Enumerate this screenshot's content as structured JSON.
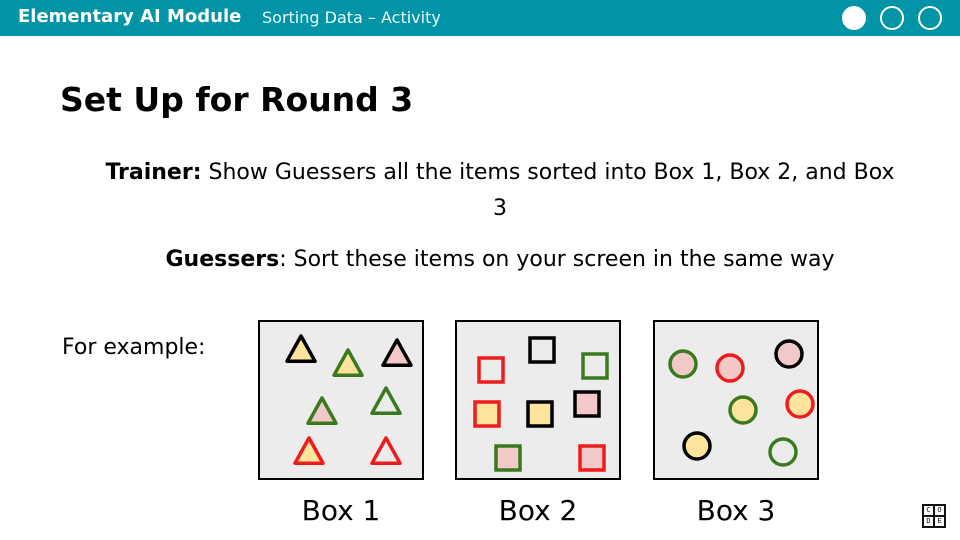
{
  "header": {
    "module_title": "Elementary AI Module",
    "activity_title": "Sorting Data – Activity",
    "progress_total": 3,
    "progress_current": 1,
    "color": "#0094a6"
  },
  "slide": {
    "title": "Set Up for Round 3",
    "trainer_label": "Trainer:",
    "trainer_text": "Show Guessers all the items sorted into Box 1, Box 2, and Box 3",
    "guessers_label": "Guessers",
    "guessers_text": ": Sort these items on your screen in the same way",
    "example_label": "For example:"
  },
  "colors": {
    "black": "#000000",
    "yellow": "#fde39b",
    "green": "#3a7a1f",
    "red": "#ee1c1c",
    "pink": "#f2c8c8",
    "box_bg": "#ececec"
  },
  "boxes": [
    {
      "label": "Box 1",
      "items": [
        {
          "shape": "triangle",
          "outline": "black",
          "fill": "yellow"
        },
        {
          "shape": "triangle",
          "outline": "green",
          "fill": "yellow"
        },
        {
          "shape": "triangle",
          "outline": "black",
          "fill": "pink"
        },
        {
          "shape": "triangle",
          "outline": "green",
          "fill": "pink"
        },
        {
          "shape": "triangle",
          "outline": "green",
          "fill": "none"
        },
        {
          "shape": "triangle",
          "outline": "red",
          "fill": "yellow"
        },
        {
          "shape": "triangle",
          "outline": "red",
          "fill": "none"
        }
      ]
    },
    {
      "label": "Box 2",
      "items": [
        {
          "shape": "square",
          "outline": "red",
          "fill": "none"
        },
        {
          "shape": "square",
          "outline": "black",
          "fill": "none"
        },
        {
          "shape": "square",
          "outline": "green",
          "fill": "none"
        },
        {
          "shape": "square",
          "outline": "red",
          "fill": "yellow"
        },
        {
          "shape": "square",
          "outline": "black",
          "fill": "yellow"
        },
        {
          "shape": "square",
          "outline": "black",
          "fill": "pink"
        },
        {
          "shape": "square",
          "outline": "green",
          "fill": "pink"
        },
        {
          "shape": "square",
          "outline": "red",
          "fill": "pink"
        }
      ]
    },
    {
      "label": "Box 3",
      "items": [
        {
          "shape": "circle",
          "outline": "green",
          "fill": "pink"
        },
        {
          "shape": "circle",
          "outline": "red",
          "fill": "pink"
        },
        {
          "shape": "circle",
          "outline": "black",
          "fill": "pink"
        },
        {
          "shape": "circle",
          "outline": "green",
          "fill": "yellow"
        },
        {
          "shape": "circle",
          "outline": "red",
          "fill": "yellow"
        },
        {
          "shape": "circle",
          "outline": "black",
          "fill": "yellow"
        },
        {
          "shape": "circle",
          "outline": "green",
          "fill": "none"
        }
      ]
    }
  ],
  "logo": {
    "letters": [
      "C",
      "O",
      "D",
      "E"
    ]
  }
}
